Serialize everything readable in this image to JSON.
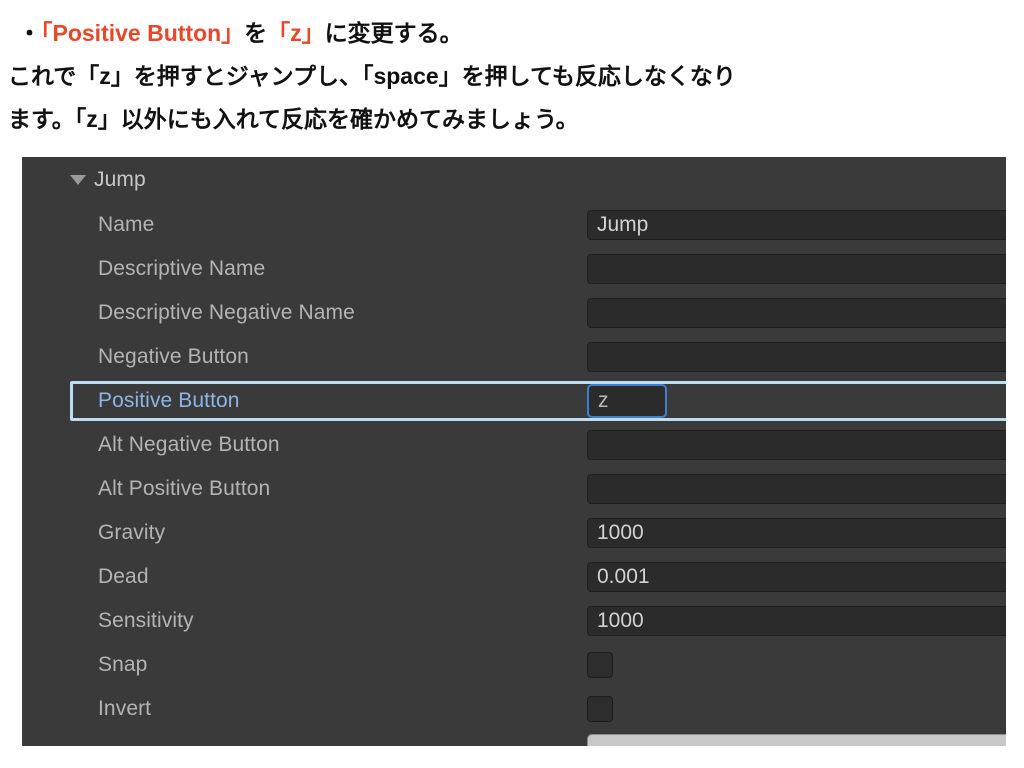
{
  "note": {
    "bullet": "・",
    "line1": {
      "highlight1": "「Positive Button」",
      "mid": "を",
      "highlight2": "「z」",
      "tail": "に変更する。"
    },
    "line2": "これで「z」を押すとジャンプし、「space」を押しても反応しなくなり",
    "line3": "ます。「z」以外にも入れて反応を確かめてみましょう。",
    "highlight_color": "#e8472a",
    "text_color": "#111111"
  },
  "inspector": {
    "foldout": {
      "arrow_icon": "triangle-down-icon",
      "label": "Jump",
      "expanded": true
    },
    "selection_color": "#bcdcf0",
    "focus_border_color": "#3f7fd0",
    "panel_bg": "#3a3a3a",
    "rows": [
      {
        "label": "Name",
        "type": "text",
        "value": "Jump",
        "selected": false
      },
      {
        "label": "Descriptive Name",
        "type": "text",
        "value": "",
        "selected": false
      },
      {
        "label": "Descriptive Negative Name",
        "type": "text",
        "value": "",
        "selected": false
      },
      {
        "label": "Negative Button",
        "type": "text",
        "value": "",
        "selected": false
      },
      {
        "label": "Positive Button",
        "type": "text",
        "value": "z",
        "selected": true
      },
      {
        "label": "Alt Negative Button",
        "type": "text",
        "value": "",
        "selected": false
      },
      {
        "label": "Alt Positive Button",
        "type": "text",
        "value": "",
        "selected": false
      },
      {
        "label": "Gravity",
        "type": "text",
        "value": "1000",
        "selected": false
      },
      {
        "label": "Dead",
        "type": "text",
        "value": "0.001",
        "selected": false
      },
      {
        "label": "Sensitivity",
        "type": "text",
        "value": "1000",
        "selected": false
      },
      {
        "label": "Snap",
        "type": "checkbox",
        "value": "",
        "checked": false,
        "selected": false
      },
      {
        "label": "Invert",
        "type": "checkbox",
        "value": "",
        "checked": false,
        "selected": false
      }
    ]
  }
}
